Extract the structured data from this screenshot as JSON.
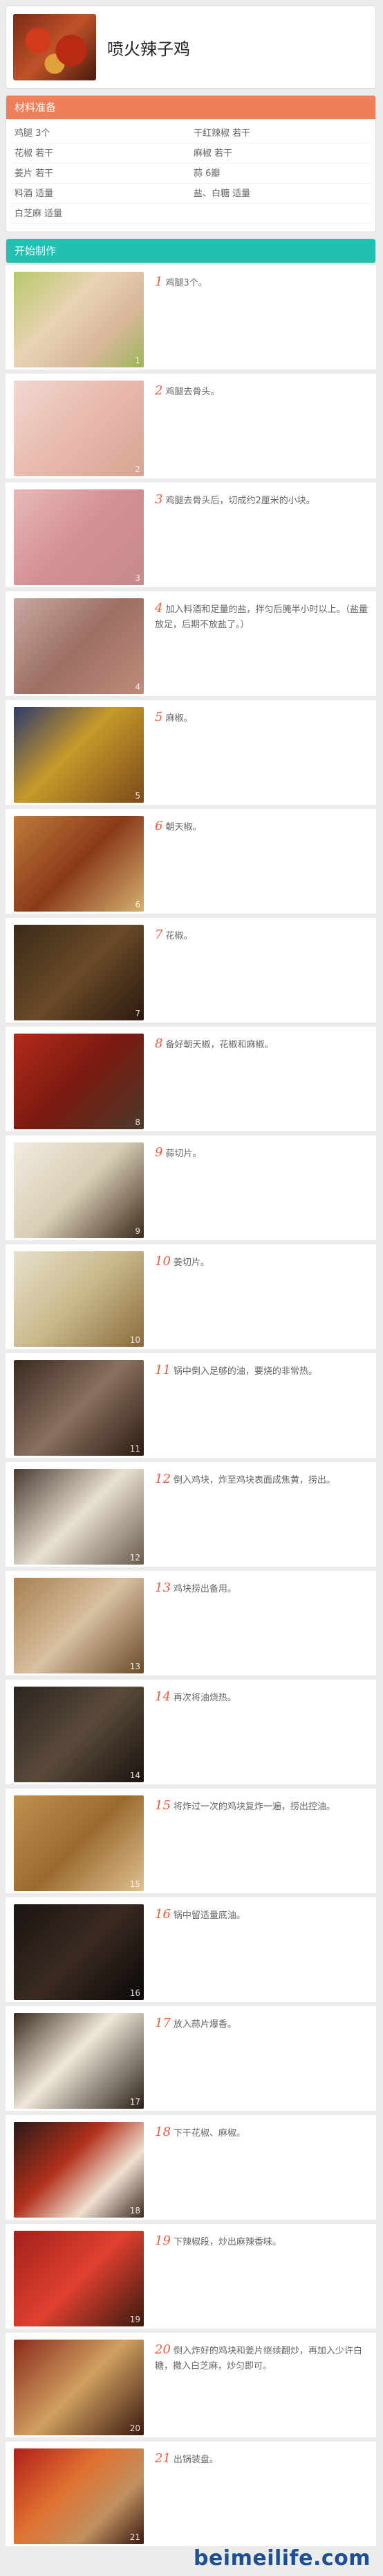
{
  "title": "喷火辣子鸡",
  "ingredients_title": "材料准备",
  "ingredients": [
    "鸡腿 3个",
    "干红辣椒 若干",
    "花椒 若干",
    "麻椒 若干",
    "姜片 若干",
    "蒜 6瓣",
    "料酒 适量",
    "盐、白糖 适量",
    "白芝麻 适量",
    ""
  ],
  "steps_title": "开始制作",
  "steps": [
    {
      "index": "1",
      "text": "鸡腿3个。"
    },
    {
      "index": "2",
      "text": "鸡腿去骨头。"
    },
    {
      "index": "3",
      "text": "鸡腿去骨头后，切成约2厘米的小块。"
    },
    {
      "index": "4",
      "text": "加入料酒和足量的盐，拌匀后腌半小时以上。（盐量放足，后期不放盐了。）"
    },
    {
      "index": "5",
      "text": "麻椒。"
    },
    {
      "index": "6",
      "text": "朝天椒。"
    },
    {
      "index": "7",
      "text": "花椒。"
    },
    {
      "index": "8",
      "text": "备好朝天椒，花椒和麻椒。"
    },
    {
      "index": "9",
      "text": "蒜切片。"
    },
    {
      "index": "10",
      "text": "姜切片。"
    },
    {
      "index": "11",
      "text": "锅中倒入足够的油，要烧的非常热。"
    },
    {
      "index": "12",
      "text": "倒入鸡块，炸至鸡块表面成焦黄，捞出。"
    },
    {
      "index": "13",
      "text": "鸡块捞出备用。"
    },
    {
      "index": "14",
      "text": "再次将油烧热。"
    },
    {
      "index": "15",
      "text": "将炸过一次的鸡块复炸一遍，捞出控油。"
    },
    {
      "index": "16",
      "text": "锅中留适量底油。"
    },
    {
      "index": "17",
      "text": "放入蒜片爆香。"
    },
    {
      "index": "18",
      "text": "下干花椒、麻椒。"
    },
    {
      "index": "19",
      "text": "下辣椒段，炒出麻辣香味。"
    },
    {
      "index": "20",
      "text": "倒入炸好的鸡块和姜片继续翻炒，再加入少许白糖，撒入白芝麻，炒匀即可。"
    },
    {
      "index": "21",
      "text": "出锅装盘。"
    }
  ],
  "watermark": "beimeilife.com",
  "colors": {
    "ingredients_header": "#ef7f5b",
    "steps_header": "#1fbfb2",
    "step_number": "#ef5a3c"
  }
}
